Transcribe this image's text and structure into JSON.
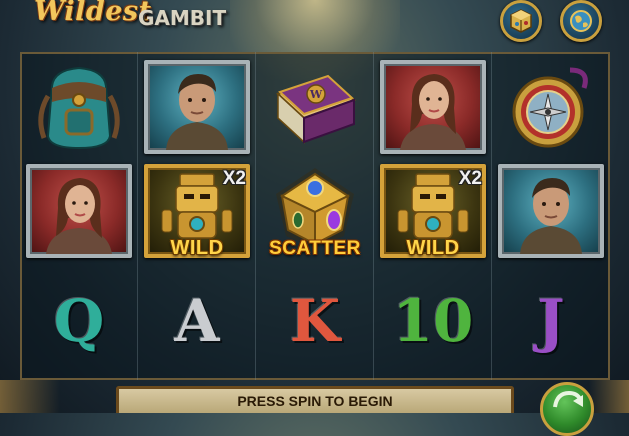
{
  "logo": {
    "word1": "Wildest",
    "word2": "GAMBIT"
  },
  "buttons": {
    "left_icon": "cube-info-icon",
    "right_icon": "globe-icon",
    "spin_icon": "spin-arrow-icon"
  },
  "reels": {
    "row1": [
      {
        "type": "image",
        "icon": "backpack-icon"
      },
      {
        "type": "image",
        "icon": "male-explorer-icon"
      },
      {
        "type": "image",
        "icon": "book-icon"
      },
      {
        "type": "image",
        "icon": "female-explorer-icon"
      },
      {
        "type": "image",
        "icon": "compass-icon"
      }
    ],
    "row2": [
      {
        "type": "image",
        "icon": "female-explorer-icon"
      },
      {
        "type": "wild",
        "label": "WILD",
        "multiplier": "X2"
      },
      {
        "type": "scatter",
        "label": "SCATTER"
      },
      {
        "type": "wild",
        "label": "WILD",
        "multiplier": "X2"
      },
      {
        "type": "image",
        "icon": "male-explorer-icon"
      }
    ],
    "row3": [
      {
        "type": "letter",
        "text": "Q",
        "color": "#2fae9a"
      },
      {
        "type": "letter",
        "text": "A",
        "color": "#c9ccd0"
      },
      {
        "type": "letter",
        "text": "K",
        "color": "#e0573e"
      },
      {
        "type": "letter",
        "text": "10",
        "color": "#4fb43e"
      },
      {
        "type": "letter",
        "text": "J",
        "color": "#9a4fc6"
      }
    ]
  },
  "message": {
    "text": "PRESS SPIN TO BEGIN"
  },
  "colors": {
    "frame_gold": "#d4a23a",
    "message_bg": "#cbbb8e",
    "spin_green": "#2f8a2a"
  }
}
